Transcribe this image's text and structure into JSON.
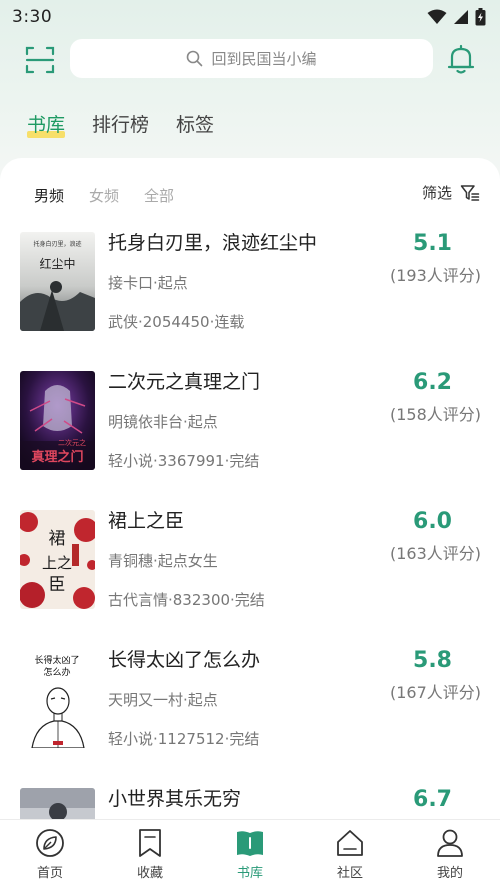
{
  "status_bar": {
    "time": "3:30"
  },
  "search": {
    "placeholder": "回到民国当小编"
  },
  "top_tabs": [
    {
      "label": "书库",
      "active": true
    },
    {
      "label": "排行榜",
      "active": false
    },
    {
      "label": "标签",
      "active": false
    }
  ],
  "sub_tabs": [
    {
      "label": "男频",
      "active": true
    },
    {
      "label": "女频",
      "active": false
    },
    {
      "label": "全部",
      "active": false
    }
  ],
  "filter_label": "筛选",
  "books": [
    {
      "title": "托身白刃里，浪迹红尘中",
      "author": "接卡口·起点",
      "meta": "武侠·2054450·连载",
      "score": "5.1",
      "ratings": "(193人评分)",
      "cover_text": "红尘中",
      "cover_small": "托身白刃里，浪迹"
    },
    {
      "title": "二次元之真理之门",
      "author": "明镜依非台·起点",
      "meta": "轻小说·3367991·完结",
      "score": "6.2",
      "ratings": "(158人评分)",
      "cover_text": "真理之门",
      "cover_small": "二次元之"
    },
    {
      "title": "裙上之臣",
      "author": "青铜穗·起点女生",
      "meta": "古代言情·832300·完结",
      "score": "6.0",
      "ratings": "(163人评分)",
      "cover_text": "裙上之臣",
      "cover_small": ""
    },
    {
      "title": "长得太凶了怎么办",
      "author": "天明又一村·起点",
      "meta": "轻小说·1127512·完结",
      "score": "5.8",
      "ratings": "(167人评分)",
      "cover_text": "长得太凶了怎么办",
      "cover_small": ""
    },
    {
      "title": "小世界其乐无穷",
      "author": "",
      "meta": "",
      "score": "6.7",
      "ratings": "",
      "cover_text": "",
      "cover_small": ""
    }
  ],
  "bottom_nav": [
    {
      "label": "首页",
      "icon": "home-leaf-icon",
      "active": false
    },
    {
      "label": "收藏",
      "icon": "bookmark-icon",
      "active": false
    },
    {
      "label": "书库",
      "icon": "book-icon",
      "active": true
    },
    {
      "label": "社区",
      "icon": "community-icon",
      "active": false
    },
    {
      "label": "我的",
      "icon": "profile-icon",
      "active": false
    }
  ],
  "colors": {
    "accent": "#2a9a78",
    "tab_active": "#1f9a63",
    "highlight": "#fad73c"
  }
}
